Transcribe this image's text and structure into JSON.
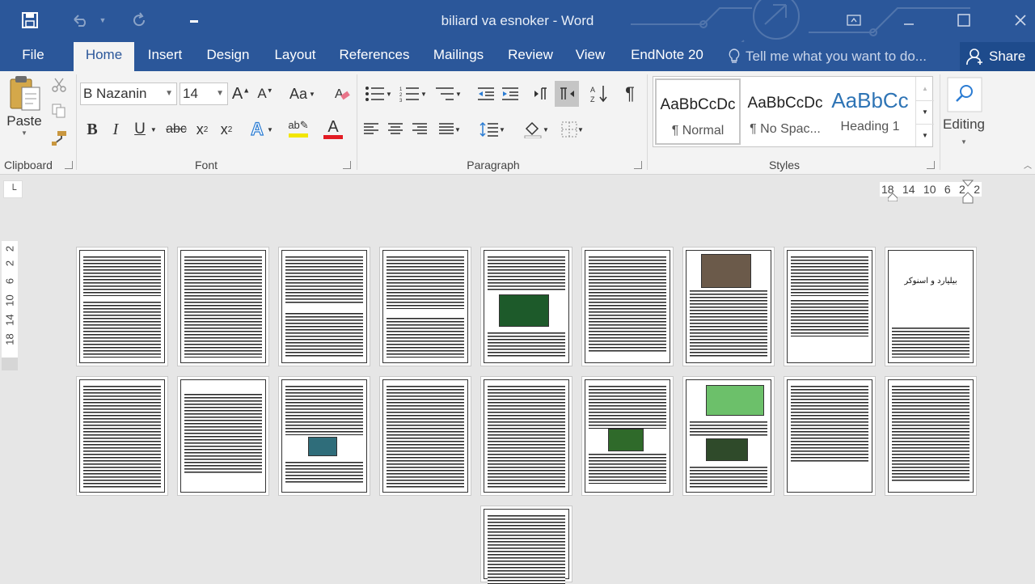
{
  "app": {
    "document_title": "biliard va esnoker - Word"
  },
  "tabs": [
    {
      "label": "File"
    },
    {
      "label": "Home"
    },
    {
      "label": "Insert"
    },
    {
      "label": "Design"
    },
    {
      "label": "Layout"
    },
    {
      "label": "References"
    },
    {
      "label": "Mailings"
    },
    {
      "label": "Review"
    },
    {
      "label": "View"
    },
    {
      "label": "EndNote 20"
    }
  ],
  "tell_me": {
    "placeholder": "Tell me what you want to do..."
  },
  "share": {
    "label": "Share"
  },
  "clipboard": {
    "paste_label": "Paste",
    "group_label": "Clipboard"
  },
  "font": {
    "name": "B Nazanin",
    "size": "14",
    "group_label": "Font",
    "change_case": "Aa",
    "font_color": "#e31b23",
    "highlight_color": "#f2e600"
  },
  "paragraph": {
    "group_label": "Paragraph"
  },
  "styles": {
    "group_label": "Styles",
    "items": [
      {
        "preview": "AaBbCcDc",
        "name": "¶ Normal"
      },
      {
        "preview": "AaBbCcDc",
        "name": "¶ No Spac..."
      },
      {
        "preview": "AaBbCc",
        "name": "Heading 1"
      }
    ]
  },
  "editing": {
    "label": "Editing"
  },
  "ruler": {
    "horizontal": [
      "18",
      "14",
      "10",
      "6",
      "2",
      "2"
    ],
    "vertical": [
      "2",
      "2",
      "6",
      "10",
      "14",
      "18"
    ]
  },
  "pages": {
    "title_page_text": "بیلیارد و اسنوکر",
    "count": 19
  },
  "colors": {
    "accent": "#2b579a",
    "ribbon_bg": "#f3f3f3",
    "workspace_bg": "#e6e6e6"
  }
}
